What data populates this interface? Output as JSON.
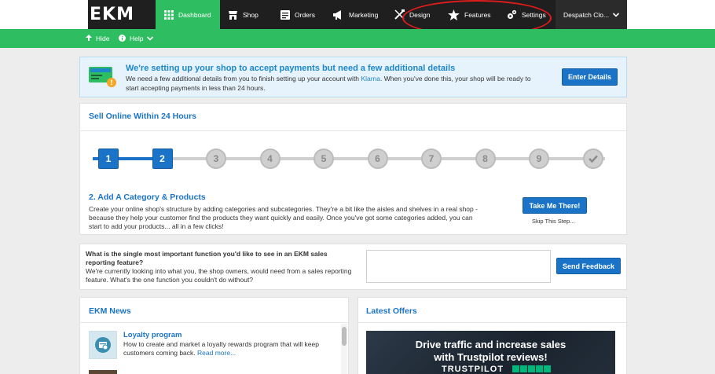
{
  "nav": {
    "logo": "EKM",
    "items": [
      {
        "label": "Dashboard",
        "icon": "grid-icon"
      },
      {
        "label": "Shop",
        "icon": "shop-icon"
      },
      {
        "label": "Orders",
        "icon": "orders-icon"
      },
      {
        "label": "Marketing",
        "icon": "megaphone-icon"
      },
      {
        "label": "Design",
        "icon": "design-icon"
      },
      {
        "label": "Features",
        "icon": "star-icon"
      },
      {
        "label": "Settings",
        "icon": "gears-icon"
      }
    ],
    "account": "Despatch Clo..."
  },
  "subbar": {
    "hide": "Hide",
    "help": "Help"
  },
  "alert": {
    "title": "We're setting up your shop to accept payments but need a few additional details",
    "text_before": "We need a few additional details from you to finish setting up your account with ",
    "link": "Klarna",
    "text_after": ". When you've done this, your shop will be ready to start accepting payments in less than 24 hours.",
    "button": "Enter Details",
    "icon_label": "Klarna"
  },
  "setup": {
    "title": "Sell Online Within 24 Hours",
    "steps": [
      "1",
      "2",
      "3",
      "4",
      "5",
      "6",
      "7",
      "8",
      "9"
    ],
    "completed_steps": 2,
    "step_title": "2. Add A Category & Products",
    "step_text": "Create your online shop's structure by adding categories and subcategories. They're a bit like the aisles and shelves in a real shop - because they help your customer find the products they want quickly and easily. Once you've got some categories added, you can start to add your products... all in a few clicks!",
    "cta": "Take Me There!",
    "skip": "Skip This Step..."
  },
  "feedback": {
    "question": "What is the single most important function you'd like to see in an EKM sales reporting feature?",
    "text": "We're currently looking into what you, the shop owners, would need from a sales reporting feature. What's the one function you couldn't do without?",
    "button": "Send Feedback"
  },
  "news": {
    "title": "EKM News",
    "item_title": "Loyalty program",
    "item_text": "How to create and market a loyalty rewards program that will keep customers coming back.",
    "read_more": "Read more..."
  },
  "offers": {
    "title": "Latest Offers",
    "line1": "Drive traffic and increase sales",
    "line2": "with Trustpilot reviews!",
    "brand": "TRUSTPILOT"
  },
  "colors": {
    "brand_green": "#2fbd62",
    "primary_blue": "#1a73c6",
    "annotation_red": "#e31b1b"
  }
}
